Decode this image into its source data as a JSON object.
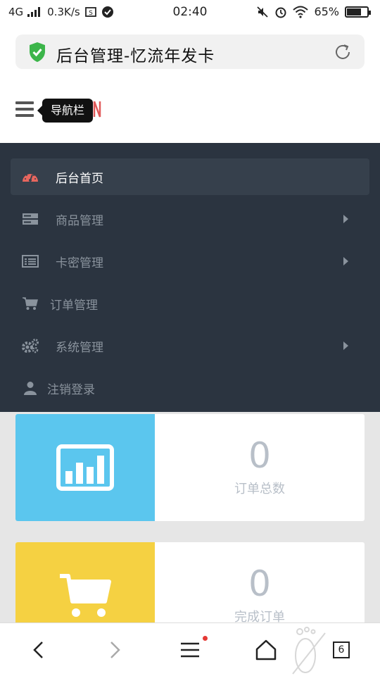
{
  "status_bar": {
    "network": "4G",
    "speed": "0.3K/s",
    "time": "02:40",
    "battery": "65%"
  },
  "browser": {
    "page_title": "后台管理-忆流年发卡",
    "tab_count": "6"
  },
  "header": {
    "tooltip": "导航栏"
  },
  "nav": {
    "items": [
      {
        "label": "后台首页",
        "icon": "dashboard-icon",
        "active": true
      },
      {
        "label": "商品管理",
        "icon": "server-icon",
        "has_submenu": true
      },
      {
        "label": "卡密管理",
        "icon": "list-icon",
        "has_submenu": true
      },
      {
        "label": "订单管理",
        "icon": "cart-icon"
      },
      {
        "label": "系统管理",
        "icon": "gears-icon",
        "has_submenu": true
      },
      {
        "label": "注销登录",
        "icon": "user-icon"
      }
    ]
  },
  "cards": [
    {
      "value": "0",
      "label": "订单总数",
      "icon": "bar-chart-icon",
      "color": "#5bc6ee"
    },
    {
      "value": "0",
      "label": "完成订单",
      "icon": "shopping-cart-icon",
      "color": "#f5d142"
    }
  ],
  "colors": {
    "nav_bg": "#2b3440",
    "nav_active_bg": "#36404c",
    "accent_red": "#e15a5a"
  }
}
